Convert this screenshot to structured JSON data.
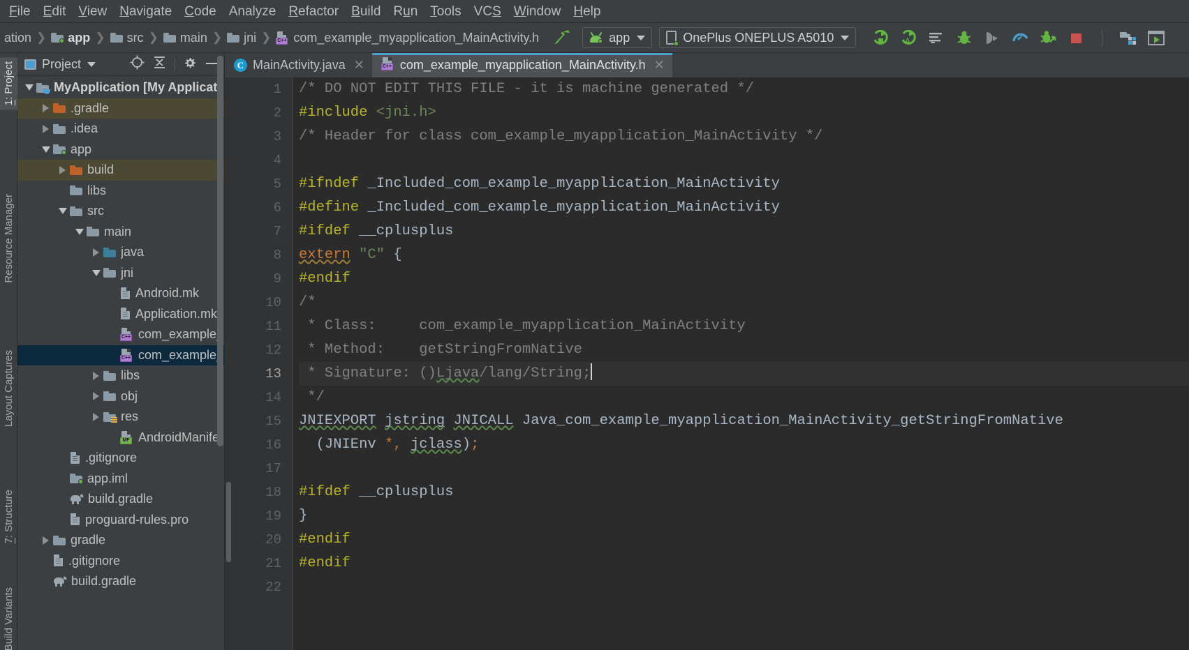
{
  "menu": {
    "items": [
      {
        "label": "File",
        "mnemonic": "F"
      },
      {
        "label": "Edit",
        "mnemonic": "E"
      },
      {
        "label": "View",
        "mnemonic": "V"
      },
      {
        "label": "Navigate",
        "mnemonic": "N"
      },
      {
        "label": "Code",
        "mnemonic": "C"
      },
      {
        "label": "Analyze",
        "mnemonic": ""
      },
      {
        "label": "Refactor",
        "mnemonic": "R"
      },
      {
        "label": "Build",
        "mnemonic": "B"
      },
      {
        "label": "Run",
        "mnemonic": "u"
      },
      {
        "label": "Tools",
        "mnemonic": "T"
      },
      {
        "label": "VCS",
        "mnemonic": "S"
      },
      {
        "label": "Window",
        "mnemonic": "W"
      },
      {
        "label": "Help",
        "mnemonic": "H"
      }
    ]
  },
  "navbar": {
    "crumbs": [
      {
        "label": "ation",
        "icon": "none",
        "bold": false
      },
      {
        "label": "app",
        "icon": "module-folder",
        "bold": true
      },
      {
        "label": "src",
        "icon": "folder",
        "bold": false
      },
      {
        "label": "main",
        "icon": "folder",
        "bold": false
      },
      {
        "label": "jni",
        "icon": "folder",
        "bold": false
      },
      {
        "label": "com_example_myapplication_MainActivity.h",
        "icon": "cpp-header",
        "bold": false
      }
    ],
    "build_icon": "hammer-icon",
    "run_config": {
      "label": "app",
      "icon": "android-icon"
    },
    "device": {
      "label": "OnePlus ONEPLUS A5010",
      "icon": "device-icon"
    },
    "actions": [
      {
        "name": "run-icon",
        "glyph": "run"
      },
      {
        "name": "apply-changes-icon",
        "glyph": "apply"
      },
      {
        "name": "debug-log-icon",
        "glyph": "loglist"
      },
      {
        "name": "debug-icon",
        "glyph": "bug"
      },
      {
        "name": "attach-debugger-icon",
        "glyph": "attach"
      },
      {
        "name": "profiler-icon",
        "glyph": "gauge"
      },
      {
        "name": "run-coverage-icon",
        "glyph": "coverage"
      },
      {
        "name": "stop-icon",
        "glyph": "stop"
      },
      {
        "name": "sdk-manager-icon",
        "glyph": "sdk"
      },
      {
        "name": "avd-manager-icon",
        "glyph": "avd"
      }
    ]
  },
  "tool_tabs": [
    {
      "label": "1: Project",
      "active": true,
      "underline": "1"
    },
    {
      "label": "Resource Manager",
      "active": false,
      "underline": ""
    },
    {
      "label": "Layout Captures",
      "active": false,
      "underline": ""
    },
    {
      "label": "7: Structure",
      "active": false,
      "underline": "7"
    },
    {
      "label": "Build Variants",
      "active": false,
      "underline": ""
    }
  ],
  "project_panel": {
    "title": "Project",
    "tools": [
      {
        "name": "locate-icon"
      },
      {
        "name": "collapse-all-icon"
      },
      {
        "name": "settings-gear-icon"
      },
      {
        "name": "hide-icon"
      }
    ],
    "tree": [
      {
        "label": "MyApplication [My Application",
        "depth": 0,
        "state": "expanded",
        "icon": "module-java",
        "bold": true,
        "row": "normal"
      },
      {
        "label": ".gradle",
        "depth": 1,
        "state": "collapsed",
        "icon": "folder-orange",
        "bold": false,
        "row": "highlight"
      },
      {
        "label": ".idea",
        "depth": 1,
        "state": "collapsed",
        "icon": "folder",
        "bold": false,
        "row": "normal"
      },
      {
        "label": "app",
        "depth": 1,
        "state": "expanded",
        "icon": "module-folder",
        "bold": false,
        "row": "normal"
      },
      {
        "label": "build",
        "depth": 2,
        "state": "collapsed",
        "icon": "folder-orange",
        "bold": false,
        "row": "highlight"
      },
      {
        "label": "libs",
        "depth": 2,
        "state": "leaf",
        "icon": "folder",
        "bold": false,
        "row": "normal"
      },
      {
        "label": "src",
        "depth": 2,
        "state": "expanded",
        "icon": "folder",
        "bold": false,
        "row": "normal"
      },
      {
        "label": "main",
        "depth": 3,
        "state": "expanded",
        "icon": "folder",
        "bold": false,
        "row": "normal"
      },
      {
        "label": "java",
        "depth": 4,
        "state": "collapsed",
        "icon": "folder-blue",
        "bold": false,
        "row": "normal"
      },
      {
        "label": "jni",
        "depth": 4,
        "state": "expanded",
        "icon": "folder",
        "bold": false,
        "row": "normal"
      },
      {
        "label": "Android.mk",
        "depth": 5,
        "state": "leaf",
        "icon": "file-doc",
        "bold": false,
        "row": "normal"
      },
      {
        "label": "Application.mk",
        "depth": 5,
        "state": "leaf",
        "icon": "file-doc",
        "bold": false,
        "row": "normal"
      },
      {
        "label": "com_example_",
        "depth": 5,
        "state": "leaf",
        "icon": "cpp-header",
        "bold": false,
        "row": "normal"
      },
      {
        "label": "com_example_",
        "depth": 5,
        "state": "leaf",
        "icon": "cpp-header",
        "bold": false,
        "row": "selected"
      },
      {
        "label": "libs",
        "depth": 4,
        "state": "collapsed",
        "icon": "folder",
        "bold": false,
        "row": "normal"
      },
      {
        "label": "obj",
        "depth": 4,
        "state": "collapsed",
        "icon": "folder",
        "bold": false,
        "row": "normal"
      },
      {
        "label": "res",
        "depth": 4,
        "state": "collapsed",
        "icon": "folder-res",
        "bold": false,
        "row": "normal"
      },
      {
        "label": "AndroidManifest.x",
        "depth": 5,
        "state": "leaf",
        "icon": "manifest",
        "bold": false,
        "row": "normal"
      },
      {
        "label": ".gitignore",
        "depth": 2,
        "state": "leaf",
        "icon": "file-doc",
        "bold": false,
        "row": "normal"
      },
      {
        "label": "app.iml",
        "depth": 2,
        "state": "leaf",
        "icon": "module-folder",
        "bold": false,
        "row": "normal"
      },
      {
        "label": "build.gradle",
        "depth": 2,
        "state": "leaf",
        "icon": "gradle",
        "bold": false,
        "row": "normal"
      },
      {
        "label": "proguard-rules.pro",
        "depth": 2,
        "state": "leaf",
        "icon": "file-doc",
        "bold": false,
        "row": "normal"
      },
      {
        "label": "gradle",
        "depth": 1,
        "state": "collapsed",
        "icon": "folder",
        "bold": false,
        "row": "normal"
      },
      {
        "label": ".gitignore",
        "depth": 1,
        "state": "leaf",
        "icon": "file-doc",
        "bold": false,
        "row": "normal"
      },
      {
        "label": "build.gradle",
        "depth": 1,
        "state": "leaf",
        "icon": "gradle",
        "bold": false,
        "row": "normal"
      }
    ]
  },
  "editor": {
    "tabs": [
      {
        "label": "MainActivity.java",
        "icon": "java-class-icon",
        "active": false,
        "closable": true
      },
      {
        "label": "com_example_myapplication_MainActivity.h",
        "icon": "cpp-header",
        "active": true,
        "closable": true
      }
    ],
    "current_line": 13,
    "first_line": 1,
    "last_line": 22,
    "lines": [
      {
        "n": 1,
        "tokens": [
          {
            "t": "/* DO NOT EDIT THIS FILE - it is machine generated */",
            "c": "t-comment"
          }
        ]
      },
      {
        "n": 2,
        "tokens": [
          {
            "t": "#include ",
            "c": "t-pre"
          },
          {
            "t": "<jni.h>",
            "c": "t-str"
          }
        ]
      },
      {
        "n": 3,
        "tokens": [
          {
            "t": "/* Header for class com_example_myapplication_MainActivity */",
            "c": "t-comment"
          }
        ]
      },
      {
        "n": 4,
        "tokens": []
      },
      {
        "n": 5,
        "tokens": [
          {
            "t": "#ifndef ",
            "c": "t-pre"
          },
          {
            "t": "_Included_com_example_myapplication_MainActivity",
            "c": "t-ident"
          }
        ]
      },
      {
        "n": 6,
        "tokens": [
          {
            "t": "#define ",
            "c": "t-pre"
          },
          {
            "t": "_Included_com_example_myapplication_MainActivity",
            "c": "t-ident"
          }
        ]
      },
      {
        "n": 7,
        "tokens": [
          {
            "t": "#ifdef ",
            "c": "t-pre"
          },
          {
            "t": "__cplusplus",
            "c": "t-ident"
          }
        ]
      },
      {
        "n": 8,
        "tokens": [
          {
            "t": "extern",
            "c": "t-kw-orange wavy-org"
          },
          {
            "t": " ",
            "c": "t-ident"
          },
          {
            "t": "\"C\"",
            "c": "t-str"
          },
          {
            "t": " {",
            "c": "t-ident"
          }
        ]
      },
      {
        "n": 9,
        "tokens": [
          {
            "t": "#endif",
            "c": "t-pre"
          }
        ]
      },
      {
        "n": 10,
        "tokens": [
          {
            "t": "/*",
            "c": "t-comment"
          }
        ]
      },
      {
        "n": 11,
        "tokens": [
          {
            "t": " * Class:     com_example_myapplication_MainActivity",
            "c": "t-comment"
          }
        ]
      },
      {
        "n": 12,
        "tokens": [
          {
            "t": " * Method:    getStringFromNative",
            "c": "t-comment"
          }
        ]
      },
      {
        "n": 13,
        "tokens": [
          {
            "t": " * Signature: ()",
            "c": "t-comment"
          },
          {
            "t": "Ljava",
            "c": "t-comment wavy"
          },
          {
            "t": "/lang/String;",
            "c": "t-comment"
          }
        ],
        "caret": true
      },
      {
        "n": 14,
        "tokens": [
          {
            "t": " */",
            "c": "t-comment"
          }
        ]
      },
      {
        "n": 15,
        "tokens": [
          {
            "t": "JNIEXPORT",
            "c": "t-ident wavy"
          },
          {
            "t": " ",
            "c": "t-ident"
          },
          {
            "t": "jstring",
            "c": "t-ident wavy"
          },
          {
            "t": " ",
            "c": "t-ident"
          },
          {
            "t": "JNICALL",
            "c": "t-ident wavy"
          },
          {
            "t": " Java_com_example_myapplication_MainActivity_getStringFromNative",
            "c": "t-ident"
          }
        ]
      },
      {
        "n": 16,
        "tokens": [
          {
            "t": "  (JNIEnv ",
            "c": "t-ident"
          },
          {
            "t": "*,",
            "c": "t-punct"
          },
          {
            "t": " ",
            "c": "t-ident"
          },
          {
            "t": "jclass",
            "c": "t-ident wavy"
          },
          {
            "t": ")",
            "c": "t-ident"
          },
          {
            "t": ";",
            "c": "t-punct"
          }
        ]
      },
      {
        "n": 17,
        "tokens": []
      },
      {
        "n": 18,
        "tokens": [
          {
            "t": "#ifdef ",
            "c": "t-pre"
          },
          {
            "t": "__cplusplus",
            "c": "t-ident"
          }
        ]
      },
      {
        "n": 19,
        "tokens": [
          {
            "t": "}",
            "c": "t-ident"
          }
        ]
      },
      {
        "n": 20,
        "tokens": [
          {
            "t": "#endif",
            "c": "t-pre"
          }
        ]
      },
      {
        "n": 21,
        "tokens": [
          {
            "t": "#endif",
            "c": "t-pre"
          }
        ]
      },
      {
        "n": 22,
        "tokens": []
      }
    ]
  },
  "colors": {
    "panel_bg": "#3c3f41",
    "editor_bg": "#2b2b2b",
    "gutter_bg": "#313335",
    "selection": "#0d293e",
    "highlight_row": "#4b4833",
    "accent_blue": "#4a9fd0",
    "green": "#62b543",
    "stop_red": "#c75450"
  }
}
